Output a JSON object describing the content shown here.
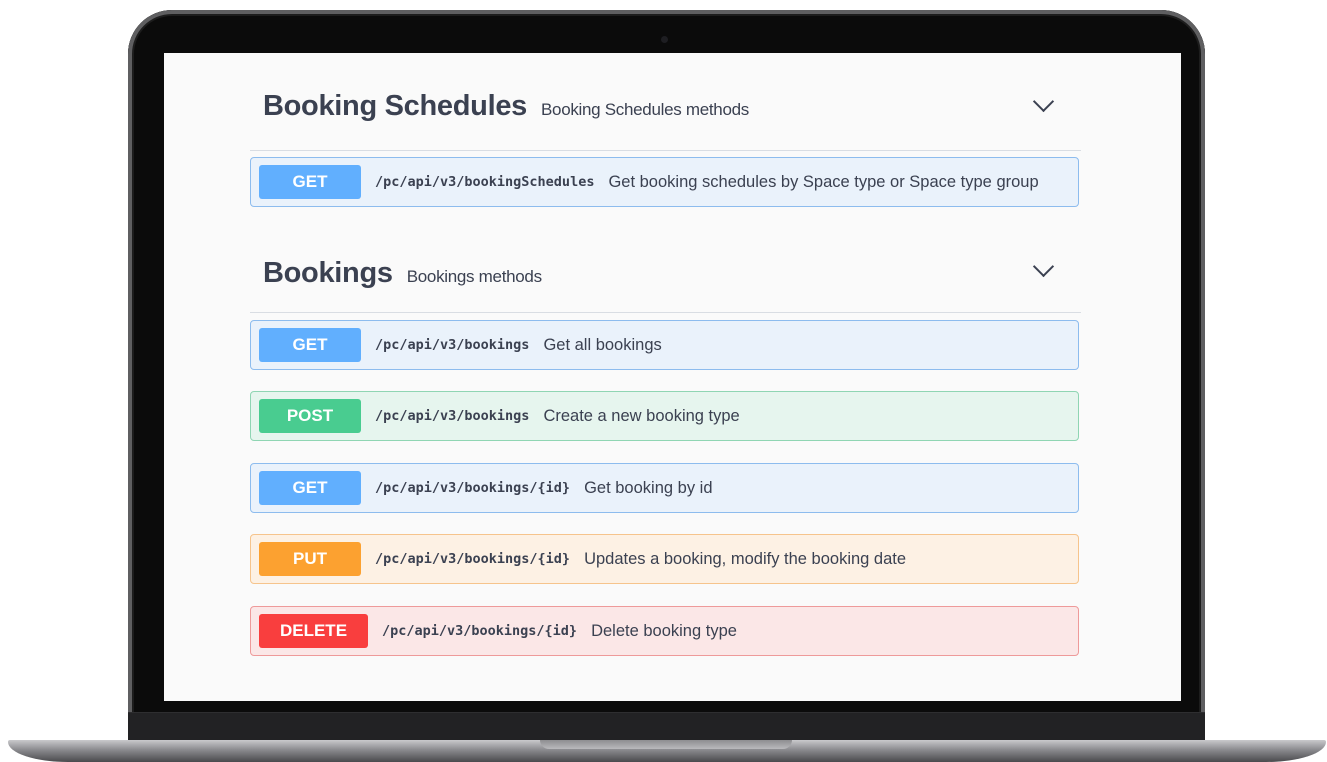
{
  "sections": [
    {
      "title": "Booking Schedules",
      "description": "Booking Schedules methods",
      "operations": [
        {
          "method": "GET",
          "path": "/pc/api/v3/bookingSchedules",
          "summary": "Get booking schedules by Space type or Space type group"
        }
      ]
    },
    {
      "title": "Bookings",
      "description": "Bookings methods",
      "operations": [
        {
          "method": "GET",
          "path": "/pc/api/v3/bookings",
          "summary": "Get all bookings"
        },
        {
          "method": "POST",
          "path": "/pc/api/v3/bookings",
          "summary": "Create a new booking type"
        },
        {
          "method": "GET",
          "path": "/pc/api/v3/bookings/{id}",
          "summary": "Get booking by id"
        },
        {
          "method": "PUT",
          "path": "/pc/api/v3/bookings/{id}",
          "summary": "Updates a booking, modify the booking date"
        },
        {
          "method": "DELETE",
          "path": "/pc/api/v3/bookings/{id}",
          "summary": "Delete booking type"
        }
      ]
    }
  ],
  "colors": {
    "get": "#61affe",
    "post": "#49cc90",
    "put": "#fca130",
    "delete": "#f93e3e",
    "text": "#3b4151"
  },
  "icons": {
    "collapse": "chevron-down-icon"
  }
}
